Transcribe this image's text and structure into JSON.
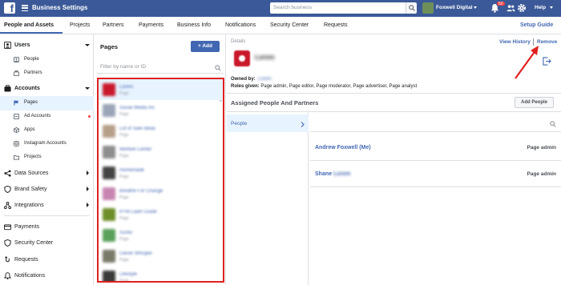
{
  "topbar": {
    "app_title": "Business Settings",
    "search_placeholder": "Search business",
    "business_name": "Foxwell Digital",
    "notification_count": "50",
    "help_label": "Help"
  },
  "tabs": {
    "items": [
      "People and Assets",
      "Projects",
      "Partners",
      "Payments",
      "Business Info",
      "Notifications",
      "Security Center",
      "Requests"
    ],
    "setup_guide": "Setup Guide"
  },
  "sidebar": {
    "users": "Users",
    "people": "People",
    "partners": "Partners",
    "accounts": "Accounts",
    "pages": "Pages",
    "ad_accounts": "Ad Accounts",
    "apps": "Apps",
    "instagram_accounts": "Instagram Accounts",
    "projects": "Projects",
    "data_sources": "Data Sources",
    "brand_safety": "Brand Safety",
    "integrations": "Integrations",
    "payments": "Payments",
    "security_center": "Security Center",
    "requests": "Requests",
    "notifications": "Notifications"
  },
  "pages_panel": {
    "title": "Pages",
    "add_label": "+ Add",
    "filter_placeholder": "Filter by name or ID",
    "items": [
      {
        "name": "Lorem",
        "sub": "Page",
        "color": "#c9182b"
      },
      {
        "name": "Social Media Inc",
        "sub": "Page",
        "color": "#9aa5b8"
      },
      {
        "name": "Lot of Sale Ideas",
        "sub": "Page",
        "color": "#b7a08a"
      },
      {
        "name": "Welfare Center",
        "sub": "Page",
        "color": "#8e8e8e"
      },
      {
        "name": "Homemade",
        "sub": "Page",
        "color": "#444444"
      },
      {
        "name": "Breathe For Change",
        "sub": "Page",
        "color": "#c785b0"
      },
      {
        "name": "KYM Lawn Guide",
        "sub": "Page",
        "color": "#6e8e2a"
      },
      {
        "name": "Sustic",
        "sub": "Page",
        "color": "#5aa05a"
      },
      {
        "name": "Clever Whisper",
        "sub": "Page",
        "color": "#7a7a6a"
      },
      {
        "name": "Lifestyle",
        "sub": "Page",
        "color": "#3a3a3a"
      }
    ]
  },
  "details": {
    "label": "Details",
    "view_history": "View History",
    "remove": "Remove",
    "page_title": "Lorem",
    "owned_by_label": "Owned by:",
    "owned_by_value": "Lorem",
    "roles_label": "Roles given:",
    "roles_value": "Page admin, Page editor, Page moderator, Page advertiser, Page analyst",
    "assigned_title": "Assigned People And Partners",
    "add_people": "Add People",
    "people_tab": "People",
    "people": [
      {
        "name": "Andrew Foxwell (Me)",
        "blur": "",
        "role": "Page admin"
      },
      {
        "name": "Shane",
        "blur": "Lorem",
        "role": "Page admin"
      }
    ]
  }
}
